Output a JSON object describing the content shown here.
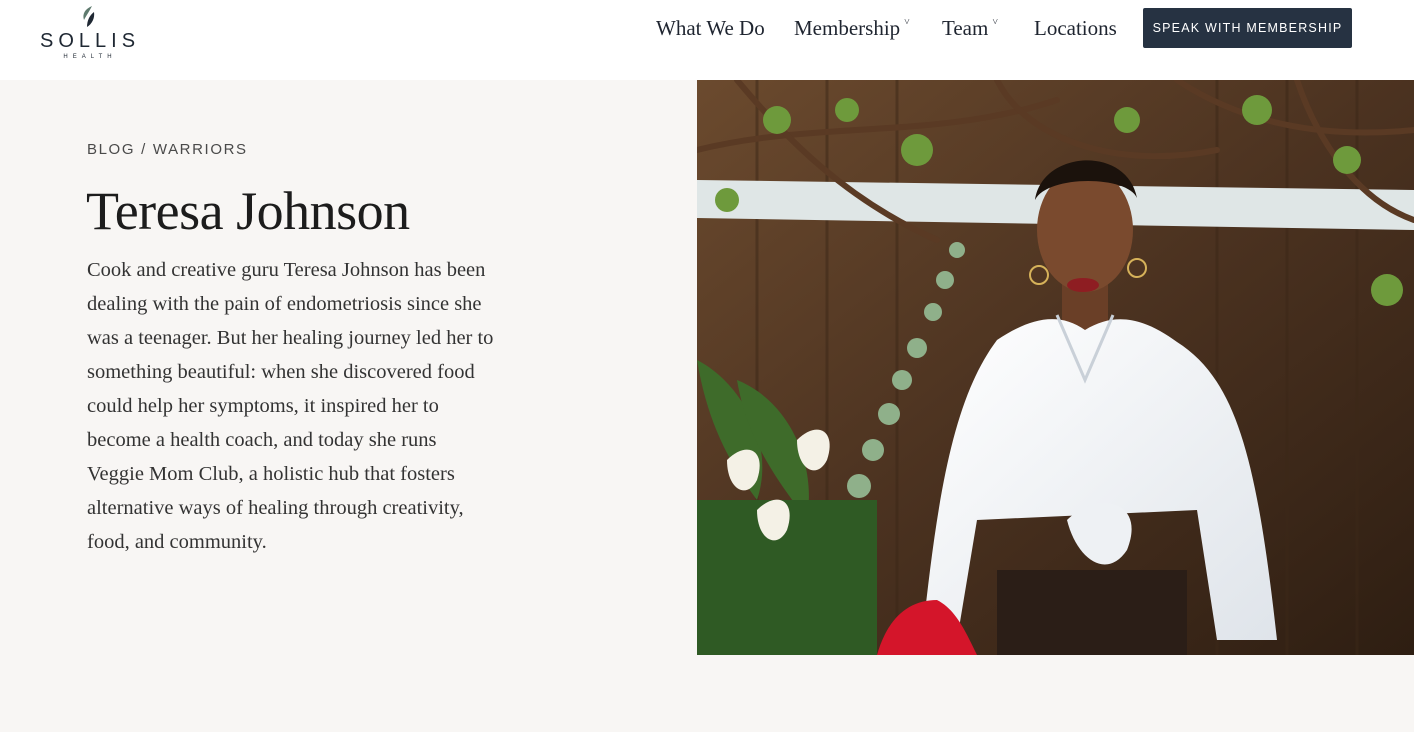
{
  "brand": {
    "name": "SOLLIS",
    "sub": "HEALTH"
  },
  "nav": {
    "items": [
      {
        "label": "What We Do"
      },
      {
        "label": "Membership"
      },
      {
        "label": "Team"
      },
      {
        "label": "Locations"
      }
    ],
    "cta_label": "SPEAK WITH MEMBERSHIP"
  },
  "breadcrumb": {
    "section": "BLOG",
    "separator": "/",
    "category": "WARRIORS"
  },
  "article": {
    "title": "Teresa Johnson",
    "description": "Cook and creative guru Teresa Johnson has been dealing with the pain of endometriosis since she was a teenager. But her healing journey led her to something beautiful: when she discovered food could help her symptoms, it inspired her to become a health coach, and today she runs Veggie Mom Club, a holistic hub that fosters alternative ways of healing through creativity, food, and community."
  },
  "colors": {
    "header_bg": "#ffffff",
    "page_bg": "#f8f6f4",
    "cta_bg": "#263242",
    "text_dark": "#1c1c1c"
  },
  "icons": {
    "logo": "leaf-logo-icon",
    "dropdown": "chevron-down-icon"
  }
}
